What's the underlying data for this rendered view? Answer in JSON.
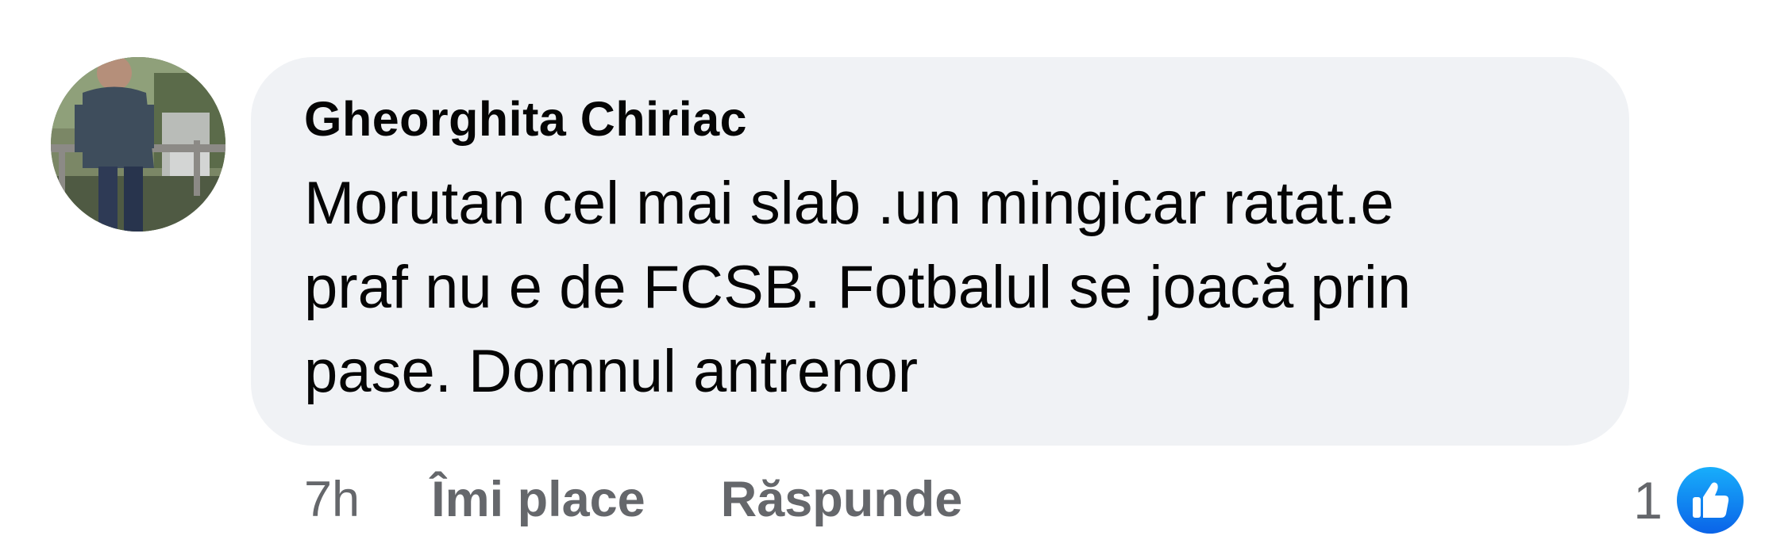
{
  "comment": {
    "author": "Gheorghita Chiriac",
    "text": "Morutan cel mai slab .un mingicar ratat.e\npraf nu e de FCSB. Fotbalul se joacă prin\npase. Domnul antrenor",
    "time": "7h",
    "like_label": "Îmi place",
    "reply_label": "Răspunde",
    "reaction_count": "1",
    "reaction_icon": "like-thumb-icon",
    "colors": {
      "bubble": "#f0f2f5",
      "text": "#050505",
      "meta": "#65676b",
      "like_blue": "#1877f2"
    }
  }
}
